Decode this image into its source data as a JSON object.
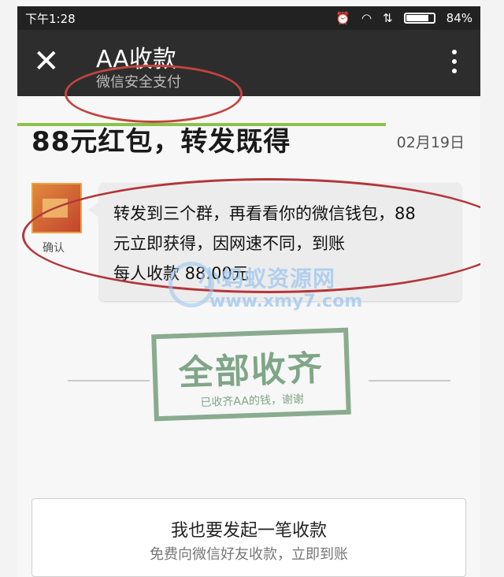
{
  "status_bar": {
    "time": "下午1:28",
    "battery": "84%"
  },
  "nav": {
    "title": "AA收款",
    "subtitle": "微信安全支付"
  },
  "message": {
    "title": "88元红包，转发既得",
    "date": "02月19日",
    "avatar_label": "确认",
    "bubble_lines": [
      "转发到三个群，再看看你的微信钱包，88",
      "元立即获得，因网速不同，到账",
      "每人收款 88.00元"
    ]
  },
  "watermark": {
    "text": "小蚂蚁资源网",
    "url": "www.xmy7.com"
  },
  "stamp": {
    "title": "全部收齐",
    "subtitle": "已收齐AA的钱，谢谢"
  },
  "bottom_card": {
    "title": "我也要发起一笔收款",
    "subtitle": "免费向微信好友收款，立即到账"
  },
  "colors": {
    "nav_bg": "#2d2d2d",
    "highlight_red": "#c4433e",
    "stamp_green": "#7fa687",
    "watermark_blue": "#9ec6ef"
  }
}
